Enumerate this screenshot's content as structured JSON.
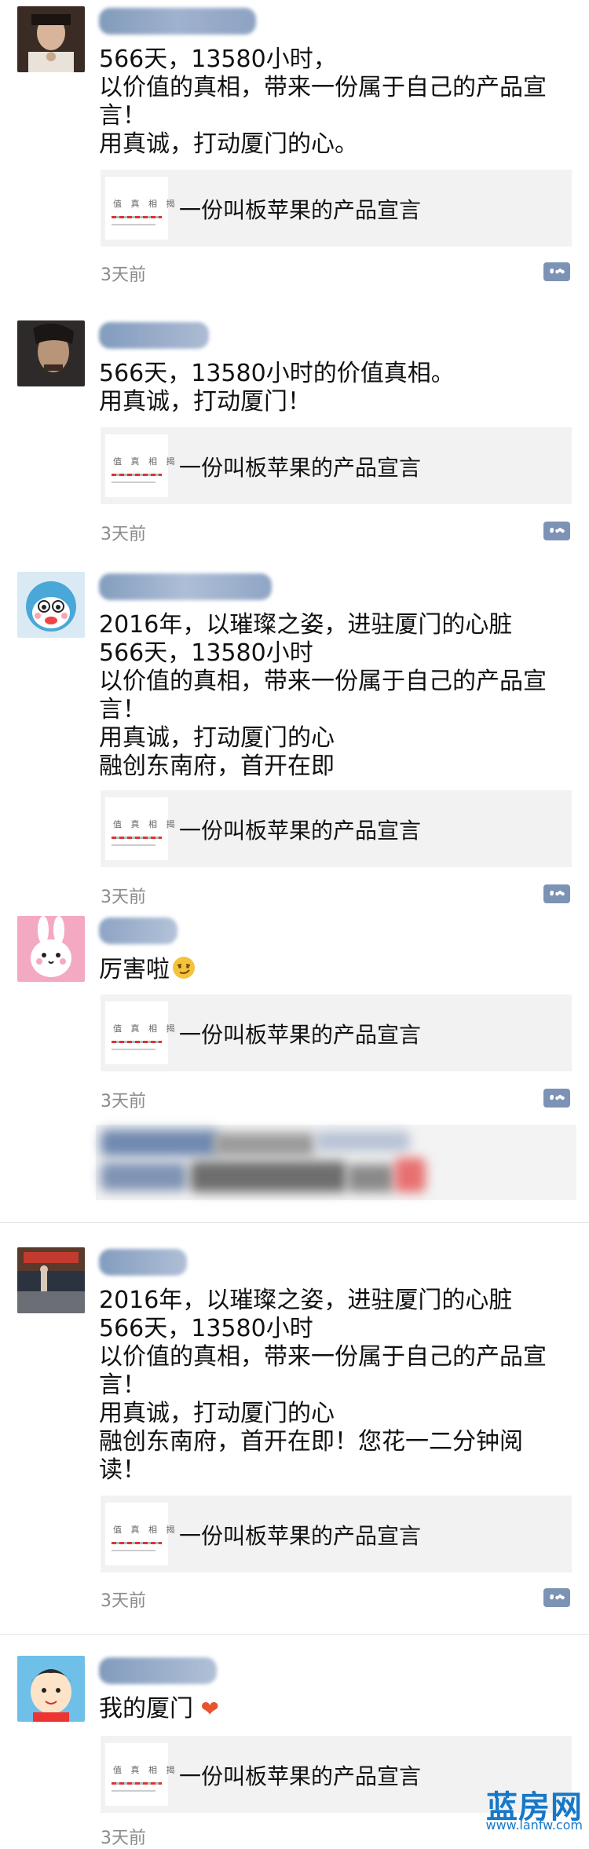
{
  "shared_card": {
    "title": "一份叫板苹果的产品宣言",
    "thumb_text": "值 真 相 揭"
  },
  "comment_icon": "comment-icon",
  "posts": [
    {
      "lines": [
        "566天，13580小时，",
        "以价值的真相，带来一份属于自己的产品宣",
        "言！",
        "用真诚，打动厦门的心。"
      ],
      "time": "3天前"
    },
    {
      "lines": [
        "566天，13580小时的价值真相。",
        "用真诚，打动厦门！"
      ],
      "time": "3天前"
    },
    {
      "lines": [
        "2016年，以璀璨之姿，进驻厦门的心脏",
        "566天，13580小时",
        "以价值的真相，带来一份属于自己的产品宣",
        "言！",
        "用真诚，打动厦门的心",
        "融创东南府，首开在即"
      ],
      "time": "3天前"
    },
    {
      "lines": [
        "厉害啦"
      ],
      "time": "3天前"
    },
    {
      "lines": [
        "2016年，以璀璨之姿，进驻厦门的心脏",
        "566天，13580小时",
        "以价值的真相，带来一份属于自己的产品宣",
        "言！",
        "用真诚，打动厦门的心",
        "融创东南府，首开在即！您花一二分钟阅",
        "读！"
      ],
      "time": "3天前"
    },
    {
      "lines": [
        "我的厦门"
      ],
      "time": "3天前"
    }
  ],
  "watermark": {
    "logo": "蓝房网",
    "url": "www.lanfw.com"
  },
  "colors": {
    "link_blue": "#7c93b6",
    "card_bg": "#f2f2f2",
    "time_gray": "#8a8a8a",
    "watermark_blue": "#1678c8"
  }
}
